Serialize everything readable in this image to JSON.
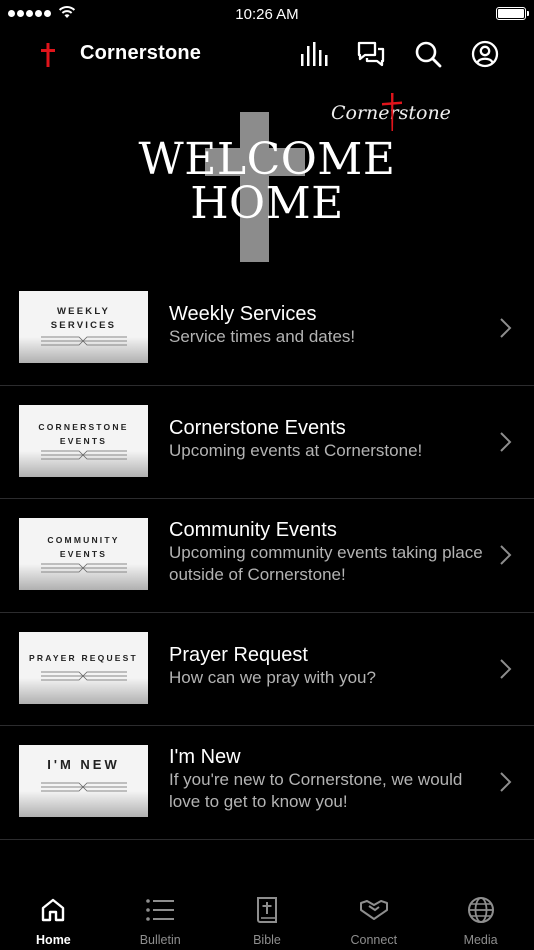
{
  "status_bar": {
    "time": "10:26 AM"
  },
  "header": {
    "title": "Cornerstone",
    "accent_color": "#e0141b"
  },
  "hero": {
    "headline_line1": "WELCOME",
    "headline_line2": "HOME",
    "script_text": "Cornerstone"
  },
  "menu": [
    {
      "thumb_text": "WEEKLY\nSERVICES",
      "title": "Weekly Services",
      "subtitle": "Service times and dates!"
    },
    {
      "thumb_text": "CORNERSTONE\nEVENTS",
      "title": "Cornerstone Events",
      "subtitle": "Upcoming events at Cornerstone!"
    },
    {
      "thumb_text": "COMMUNITY\nEVENTS",
      "title": "Community Events",
      "subtitle": "Upcoming community events taking place outside of Cornerstone!"
    },
    {
      "thumb_text": "PRAYER REQUEST",
      "title": "Prayer Request",
      "subtitle": "How can we pray with you?"
    },
    {
      "thumb_text": "I'M NEW",
      "title": "I'm New",
      "subtitle": "If you're new to Cornerstone, we would love to get to know you!"
    }
  ],
  "tabs": [
    {
      "label": "Home",
      "icon": "home-icon",
      "active": true
    },
    {
      "label": "Bulletin",
      "icon": "list-icon",
      "active": false
    },
    {
      "label": "Bible",
      "icon": "bible-icon",
      "active": false
    },
    {
      "label": "Connect",
      "icon": "handshake-icon",
      "active": false
    },
    {
      "label": "Media",
      "icon": "globe-icon",
      "active": false
    }
  ]
}
